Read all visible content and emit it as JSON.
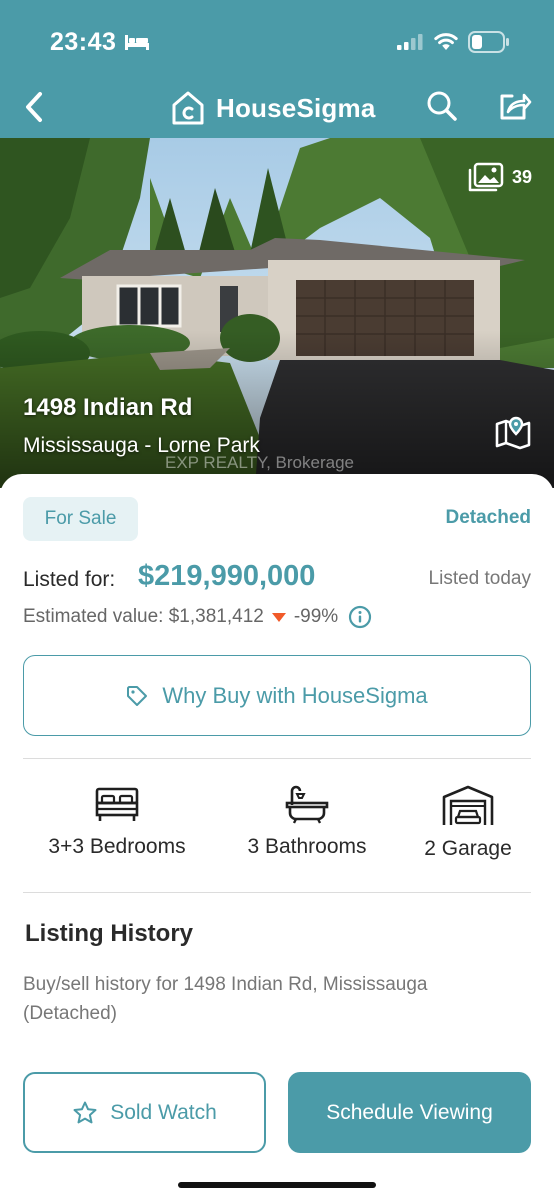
{
  "status_bar": {
    "time": "23:43"
  },
  "nav": {
    "brand": "HouseSigma"
  },
  "hero": {
    "photo_count": "39",
    "address": "1498 Indian Rd",
    "area": "Mississauga - Lorne Park",
    "brokerage": "EXP REALTY, Brokerage"
  },
  "listing": {
    "status_badge": "For Sale",
    "property_type": "Detached",
    "listed_label": "Listed for:",
    "price": "$219,990,000",
    "listed_when": "Listed today",
    "estimate_label": "Estimated value: $1,381,412",
    "estimate_change": "-99%",
    "why_buy_label": "Why Buy with HouseSigma"
  },
  "features": {
    "bedrooms": "3+3 Bedrooms",
    "bathrooms": "3 Bathrooms",
    "garage": "2 Garage"
  },
  "history": {
    "title": "Listing History",
    "description": "Buy/sell history for 1498 Indian Rd, Mississauga (Detached)"
  },
  "actions": {
    "sold_watch": "Sold Watch",
    "schedule_viewing": "Schedule Viewing"
  },
  "colors": {
    "brand_teal": "#4b9ba8",
    "badge_bg": "#e6f2f4",
    "down_arrow": "#f15a29"
  },
  "icons": [
    "back-icon",
    "house-logo-icon",
    "search-icon",
    "share-icon",
    "gallery-icon",
    "map-icon",
    "tag-icon",
    "info-icon",
    "bed-icon",
    "bathtub-icon",
    "garage-icon",
    "star-icon"
  ]
}
